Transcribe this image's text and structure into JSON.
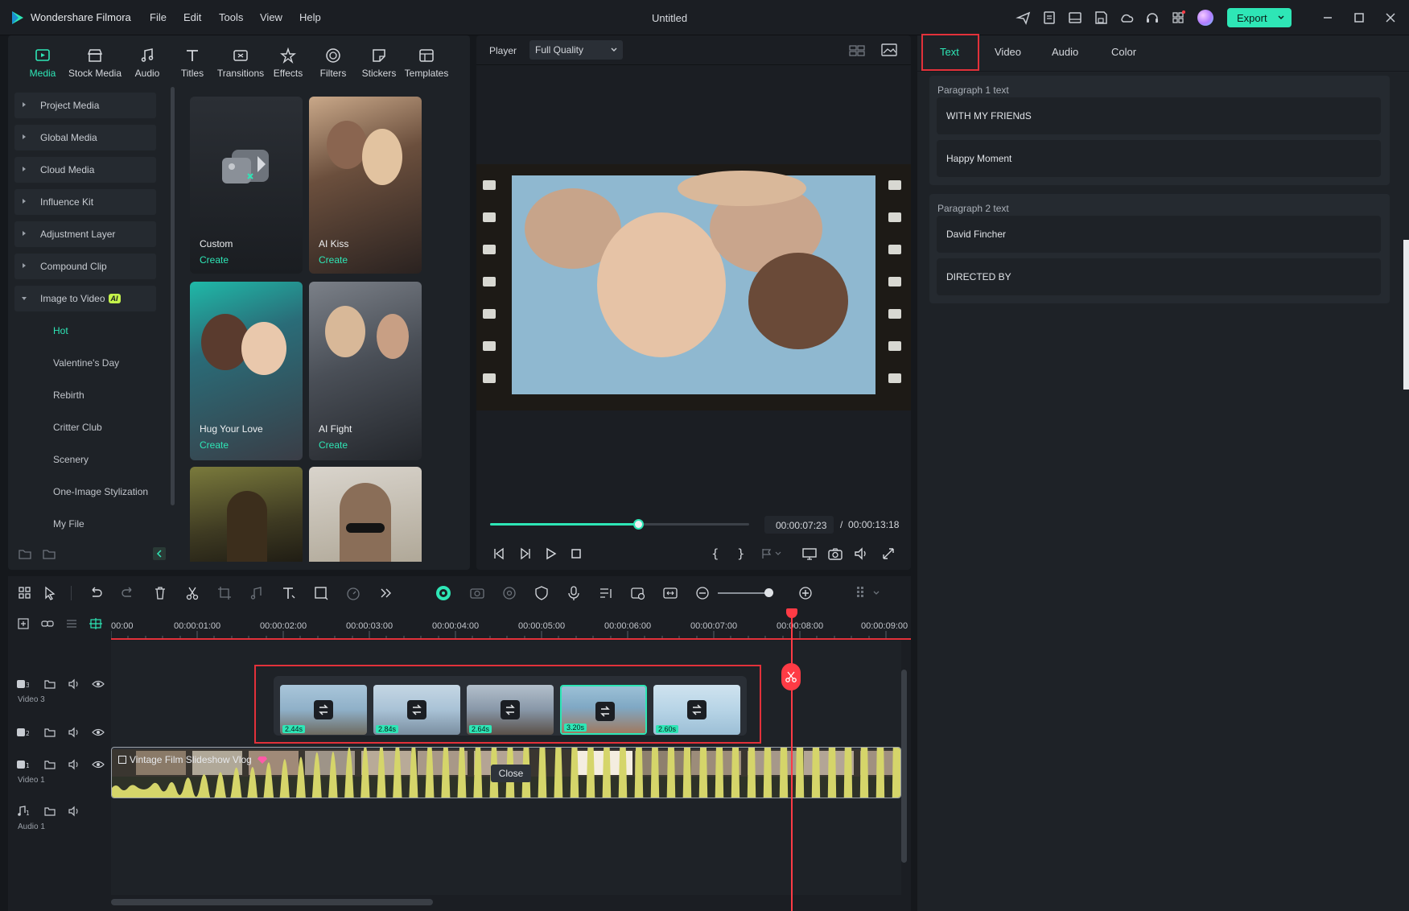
{
  "app": {
    "name": "Wondershare Filmora",
    "title": "Untitled",
    "menu": [
      "File",
      "Edit",
      "Tools",
      "View",
      "Help"
    ],
    "export_label": "Export"
  },
  "left_tabs": [
    {
      "label": "Media",
      "icon": "media-icon",
      "active": true
    },
    {
      "label": "Stock Media",
      "icon": "stock-media-icon"
    },
    {
      "label": "Audio",
      "icon": "music-note-icon"
    },
    {
      "label": "Titles",
      "icon": "text-t-icon"
    },
    {
      "label": "Transitions",
      "icon": "transitions-icon"
    },
    {
      "label": "Effects",
      "icon": "effects-icon"
    },
    {
      "label": "Filters",
      "icon": "filters-icon"
    },
    {
      "label": "Stickers",
      "icon": "stickers-icon"
    },
    {
      "label": "Templates",
      "icon": "templates-icon"
    }
  ],
  "tree": [
    {
      "label": "Project Media"
    },
    {
      "label": "Global Media"
    },
    {
      "label": "Cloud Media"
    },
    {
      "label": "Influence Kit"
    },
    {
      "label": "Adjustment Layer"
    },
    {
      "label": "Compound Clip"
    },
    {
      "label": "Image to Video",
      "badge": "AI",
      "expanded": true
    }
  ],
  "tree_sub": [
    "Hot",
    "Valentine's Day",
    "Rebirth",
    "Critter Club",
    "Scenery",
    "One-Image Stylization",
    "My File"
  ],
  "cards": [
    {
      "label": "Custom",
      "action": "Create"
    },
    {
      "label": "AI Kiss",
      "action": "Create"
    },
    {
      "label": "Hug Your Love",
      "action": "Create"
    },
    {
      "label": "AI Fight",
      "action": "Create"
    }
  ],
  "player": {
    "label": "Player",
    "quality": "Full Quality",
    "current_time": "00:00:07:23",
    "separator": "/",
    "total_time": "00:00:13:18",
    "progress": 0.57
  },
  "right_panel": {
    "tabs": [
      "Text",
      "Video",
      "Audio",
      "Color"
    ],
    "active_tab": "Text",
    "sections": [
      {
        "title": "Paragraph 1 text",
        "fields": [
          "WITH MY FRIENdS",
          "Happy Moment"
        ]
      },
      {
        "title": "Paragraph 2 text",
        "fields": [
          "David Fincher",
          "DIRECTED BY"
        ]
      }
    ]
  },
  "timeline": {
    "ruler": [
      "00:00",
      "00:00:01:00",
      "00:00:02:00",
      "00:00:03:00",
      "00:00:04:00",
      "00:00:05:00",
      "00:00:06:00",
      "00:00:07:00",
      "00:00:08:00",
      "00:00:09:00"
    ],
    "tracks": [
      {
        "name": "Video 3",
        "index": "3"
      },
      {
        "name": "",
        "index": "2"
      },
      {
        "name": "Video 1",
        "index": "1"
      },
      {
        "name": "Audio 1",
        "index": "1"
      }
    ],
    "clips": [
      {
        "duration": "2.44s",
        "color": "#8fb0c8"
      },
      {
        "duration": "2.84s",
        "color": "#a9c2d6"
      },
      {
        "duration": "2.64s",
        "color": "#8897a8"
      },
      {
        "duration": "3.20s",
        "color": "#7fa8c4",
        "selected": true
      },
      {
        "duration": "2.60s",
        "color": "#b7d4e6"
      }
    ],
    "main_clip_title": "Vintage Film Slideshow Vlog",
    "tooltip": "Close",
    "colors": {
      "accent": "#2ee6b6",
      "playhead": "#ff3b45",
      "highlight": "#e2313a"
    }
  }
}
